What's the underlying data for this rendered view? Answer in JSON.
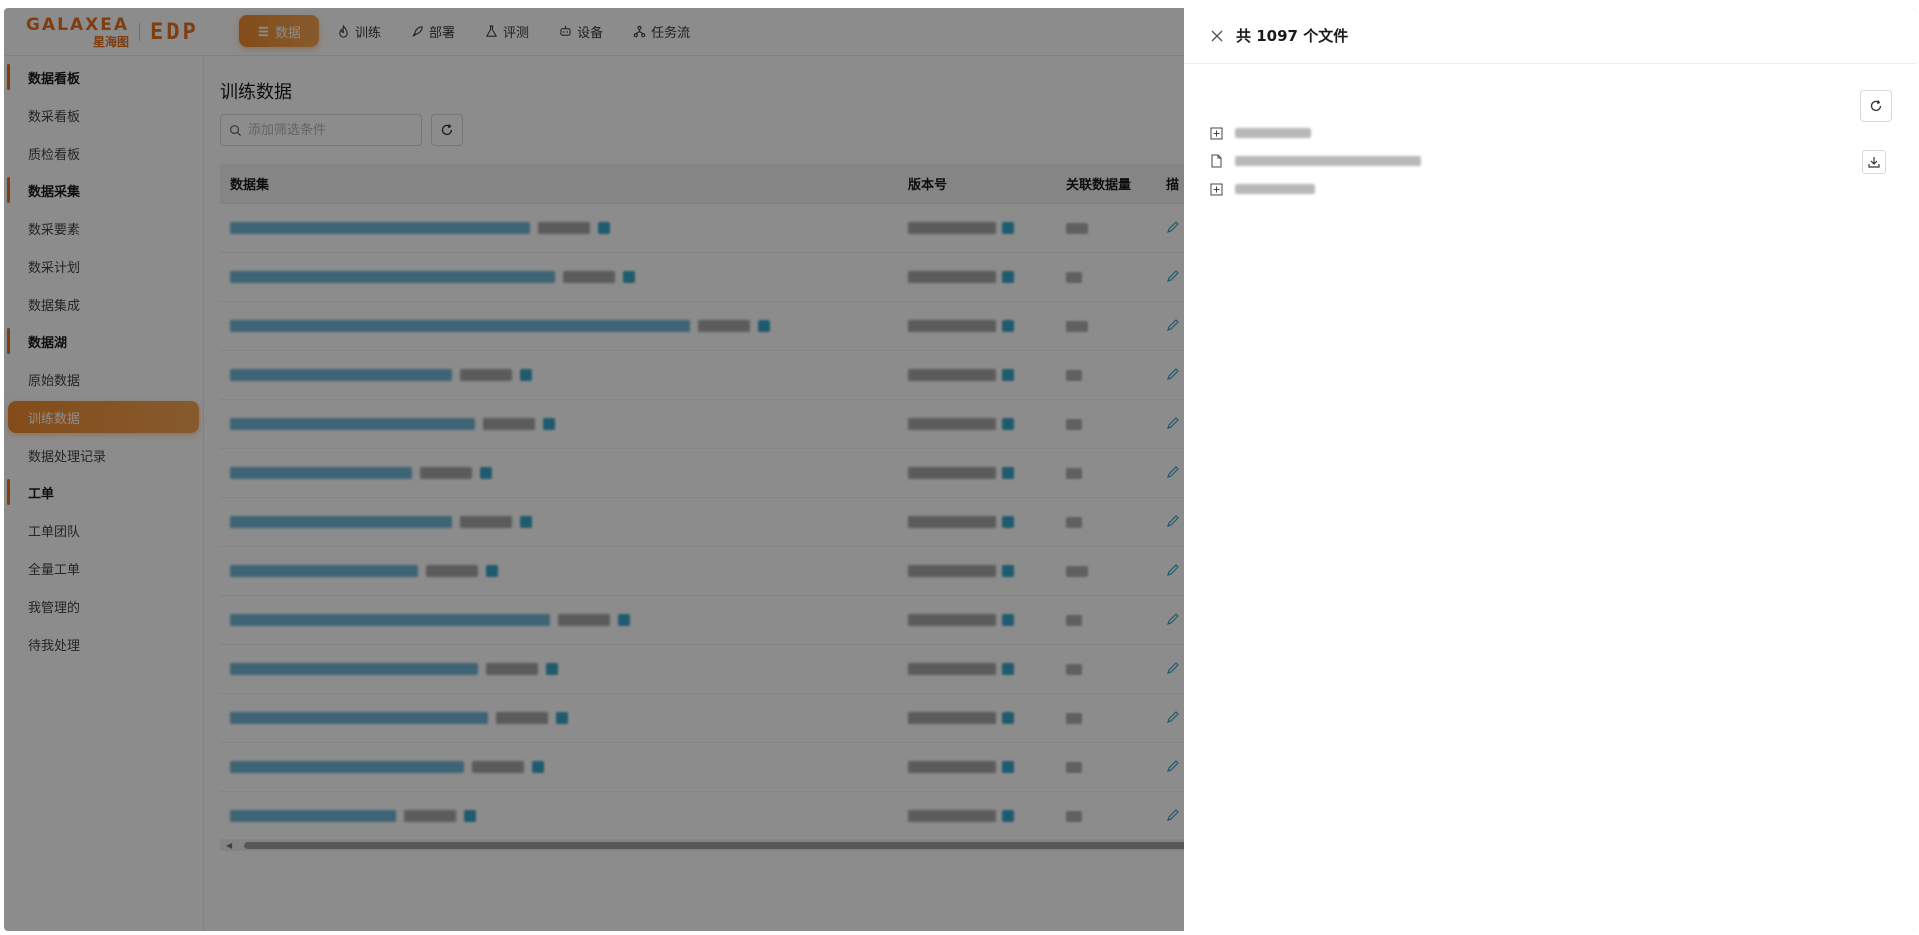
{
  "brand": {
    "name_en": "GALAXEA",
    "name_cn": "星海图",
    "product": "EDP"
  },
  "nav": [
    {
      "label": "数据",
      "icon": "database-icon",
      "active": true
    },
    {
      "label": "训练",
      "icon": "fire-icon",
      "active": false
    },
    {
      "label": "部署",
      "icon": "rocket-icon",
      "active": false
    },
    {
      "label": "评测",
      "icon": "flask-icon",
      "active": false
    },
    {
      "label": "设备",
      "icon": "robot-icon",
      "active": false
    },
    {
      "label": "任务流",
      "icon": "flow-icon",
      "active": false
    }
  ],
  "sidebar": {
    "groups": [
      {
        "title": "数据看板",
        "items": [
          {
            "label": "数采看板"
          },
          {
            "label": "质检看板"
          }
        ]
      },
      {
        "title": "数据采集",
        "items": [
          {
            "label": "数采要素"
          },
          {
            "label": "数采计划"
          },
          {
            "label": "数据集成"
          }
        ]
      },
      {
        "title": "数据湖",
        "items": [
          {
            "label": "原始数据"
          },
          {
            "label": "训练数据",
            "active": true
          },
          {
            "label": "数据处理记录"
          }
        ]
      },
      {
        "title": "工单",
        "items": [
          {
            "label": "工单团队"
          },
          {
            "label": "全量工单"
          },
          {
            "label": "我管理的"
          },
          {
            "label": "待我处理"
          }
        ]
      }
    ]
  },
  "main": {
    "title": "训练数据",
    "filter_placeholder": "添加筛选条件",
    "columns": [
      "数据集",
      "版本号",
      "关联数据量",
      "描"
    ],
    "row_count": 13
  },
  "drawer": {
    "title": "共 1097 个文件",
    "files": [
      {
        "type": "folder",
        "icon": "folder-expand-icon"
      },
      {
        "type": "file",
        "icon": "file-icon",
        "downloadable": true
      },
      {
        "type": "folder",
        "icon": "folder-expand-icon"
      }
    ]
  },
  "colors": {
    "accent": "#e8721f",
    "accent_light": "#f6a655",
    "link_blur": "#58a8cf"
  }
}
